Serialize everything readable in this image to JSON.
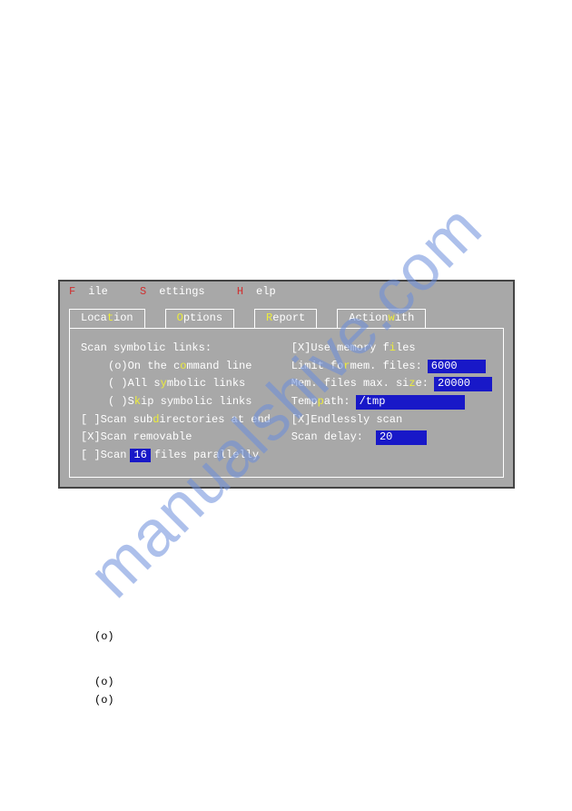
{
  "watermark": "manualshive.com",
  "menubar": {
    "file_hot": "F",
    "file_rest": "ile",
    "settings_hot": "S",
    "settings_rest": "ettings",
    "help_hot": "H",
    "help_rest": "elp"
  },
  "tabs": {
    "location": {
      "pre": "Loca",
      "hot": "t",
      "post": "ion"
    },
    "options": {
      "pre": "",
      "hot": "O",
      "post": "ptions"
    },
    "report": {
      "pre": "",
      "hot": "R",
      "post": "eport"
    },
    "actionwith": {
      "pre": "Action",
      "hot": "w",
      "post": "ith"
    }
  },
  "left": {
    "groupLabel": "Scan symbolic links:",
    "radio1": {
      "mark": "(o)",
      "pre": " On the c",
      "hot": "o",
      "post": "mmand line"
    },
    "radio2": {
      "mark": "( )",
      "pre": " All s",
      "hot": "y",
      "post": "mbolic links"
    },
    "radio3": {
      "mark": "( )",
      "pre": " S",
      "hot": "k",
      "post": "ip symbolic links"
    },
    "sub": {
      "mark": "[ ]",
      "pre": " Scan sub",
      "hot": "d",
      "post": "irectories at end"
    },
    "removable": {
      "mark": "[X]",
      "text": " Scan removable"
    },
    "parallel": {
      "mark": "[ ]",
      "pre": " Scan ",
      "num": "16",
      "post": " files parallelly"
    }
  },
  "right": {
    "useMem": {
      "mark": "[X]",
      "pre": " Use memory f",
      "hot": "i",
      "post": "les"
    },
    "limit": {
      "pre": "Limit fo",
      "hot": "r",
      "post": " mem. files:",
      "value": "6000"
    },
    "max": {
      "pre": "Mem. files max. si",
      "hot": "z",
      "post": "e:",
      "value": "20000"
    },
    "tmp": {
      "pre": "Temp ",
      "hot": "p",
      "post": "ath:",
      "value": "/tmp"
    },
    "endless": {
      "mark": "[X]",
      "text": " Endlessly scan"
    },
    "delay": {
      "label": "Scan delay:",
      "value": "20"
    }
  },
  "below": {
    "r1": "(o)",
    "r2": "(o)",
    "r3": "(o)"
  }
}
